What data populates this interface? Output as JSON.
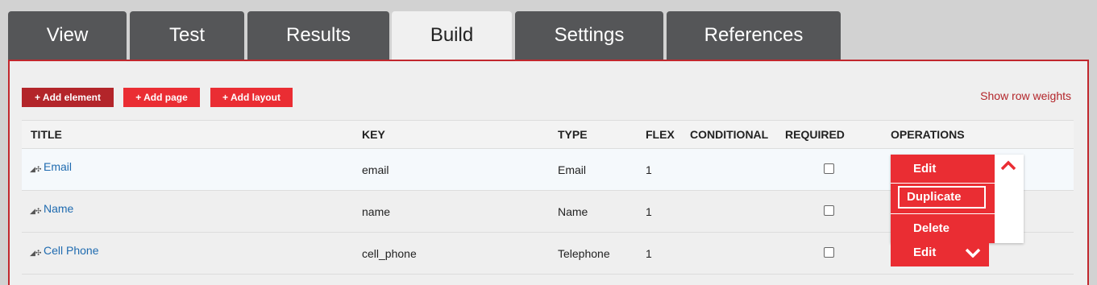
{
  "tabs": [
    {
      "label": "View"
    },
    {
      "label": "Test"
    },
    {
      "label": "Results"
    },
    {
      "label": "Build",
      "active": true
    },
    {
      "label": "Settings"
    },
    {
      "label": "References"
    }
  ],
  "toolbar": {
    "add_element": "+ Add element",
    "add_page": "+ Add page",
    "add_layout": "+ Add layout",
    "show_row_weights": "Show row weights"
  },
  "table": {
    "headers": {
      "title": "TITLE",
      "key": "KEY",
      "type": "TYPE",
      "flex": "FLEX",
      "conditional": "CONDITIONAL",
      "required": "REQUIRED",
      "operations": "OPERATIONS"
    },
    "rows": [
      {
        "title": "Email",
        "key": "email",
        "type": "Email",
        "flex": "1"
      },
      {
        "title": "Name",
        "key": "name",
        "type": "Name",
        "flex": "1"
      },
      {
        "title": "Cell Phone",
        "key": "cell_phone",
        "type": "Telephone",
        "flex": "1"
      }
    ]
  },
  "operations_menu": {
    "edit": "Edit",
    "duplicate": "Duplicate",
    "delete": "Delete",
    "next_row_edit": "Edit"
  },
  "icons": {
    "drag_handle": "drag-handle-icon",
    "collapse": "chevron-up-icon",
    "expand": "chevron-down-icon"
  },
  "colors": {
    "accent": "#ea2d33",
    "accent_dark": "#b3252a",
    "tab_inactive": "#555658",
    "link": "#1f6bb0"
  }
}
